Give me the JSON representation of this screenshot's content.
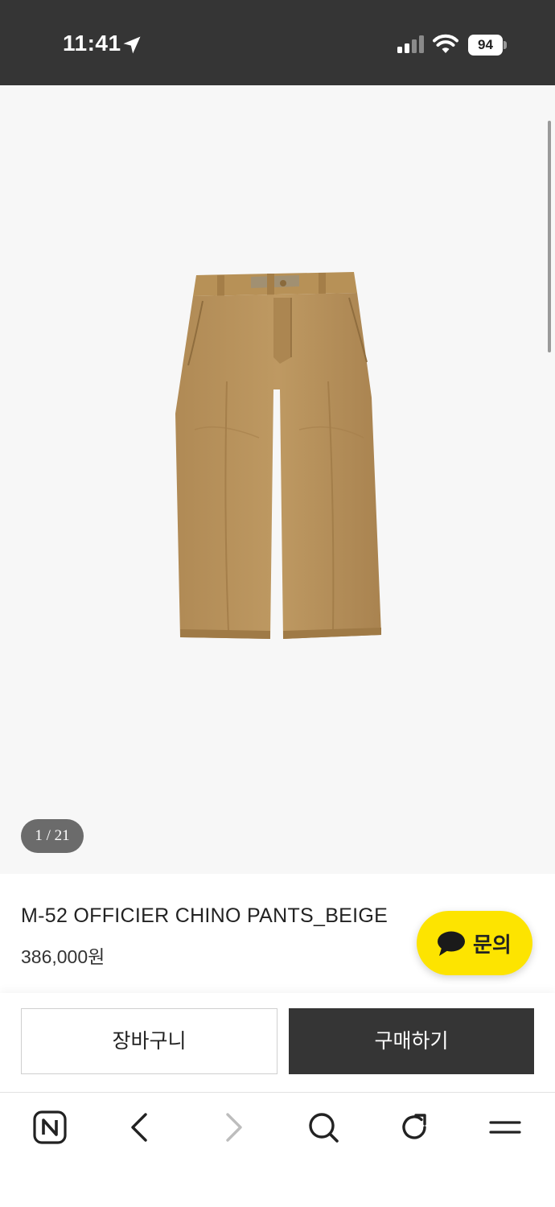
{
  "status_bar": {
    "time": "11:41",
    "battery_level": "94",
    "icons": [
      "location-arrow-icon",
      "cellular-signal-icon",
      "wifi-icon",
      "battery-icon"
    ]
  },
  "gallery": {
    "counter": "1 / 21",
    "image": "product-photo-beige-chino-pants",
    "background": "#f7f7f7"
  },
  "product": {
    "name": "M-52 OFFICIER CHINO PANTS_BEIGE",
    "price": "386,000원"
  },
  "inquiry": {
    "label": "문의",
    "icon": "chat-bubble-icon",
    "color": "#fde400"
  },
  "actions": {
    "cart_label": "장바구니",
    "buy_label": "구매하기",
    "buy_color": "#353535"
  },
  "toolbar": {
    "icons": [
      "naver-home-icon",
      "back-icon",
      "forward-icon",
      "search-icon",
      "refresh-icon",
      "menu-icon"
    ]
  }
}
